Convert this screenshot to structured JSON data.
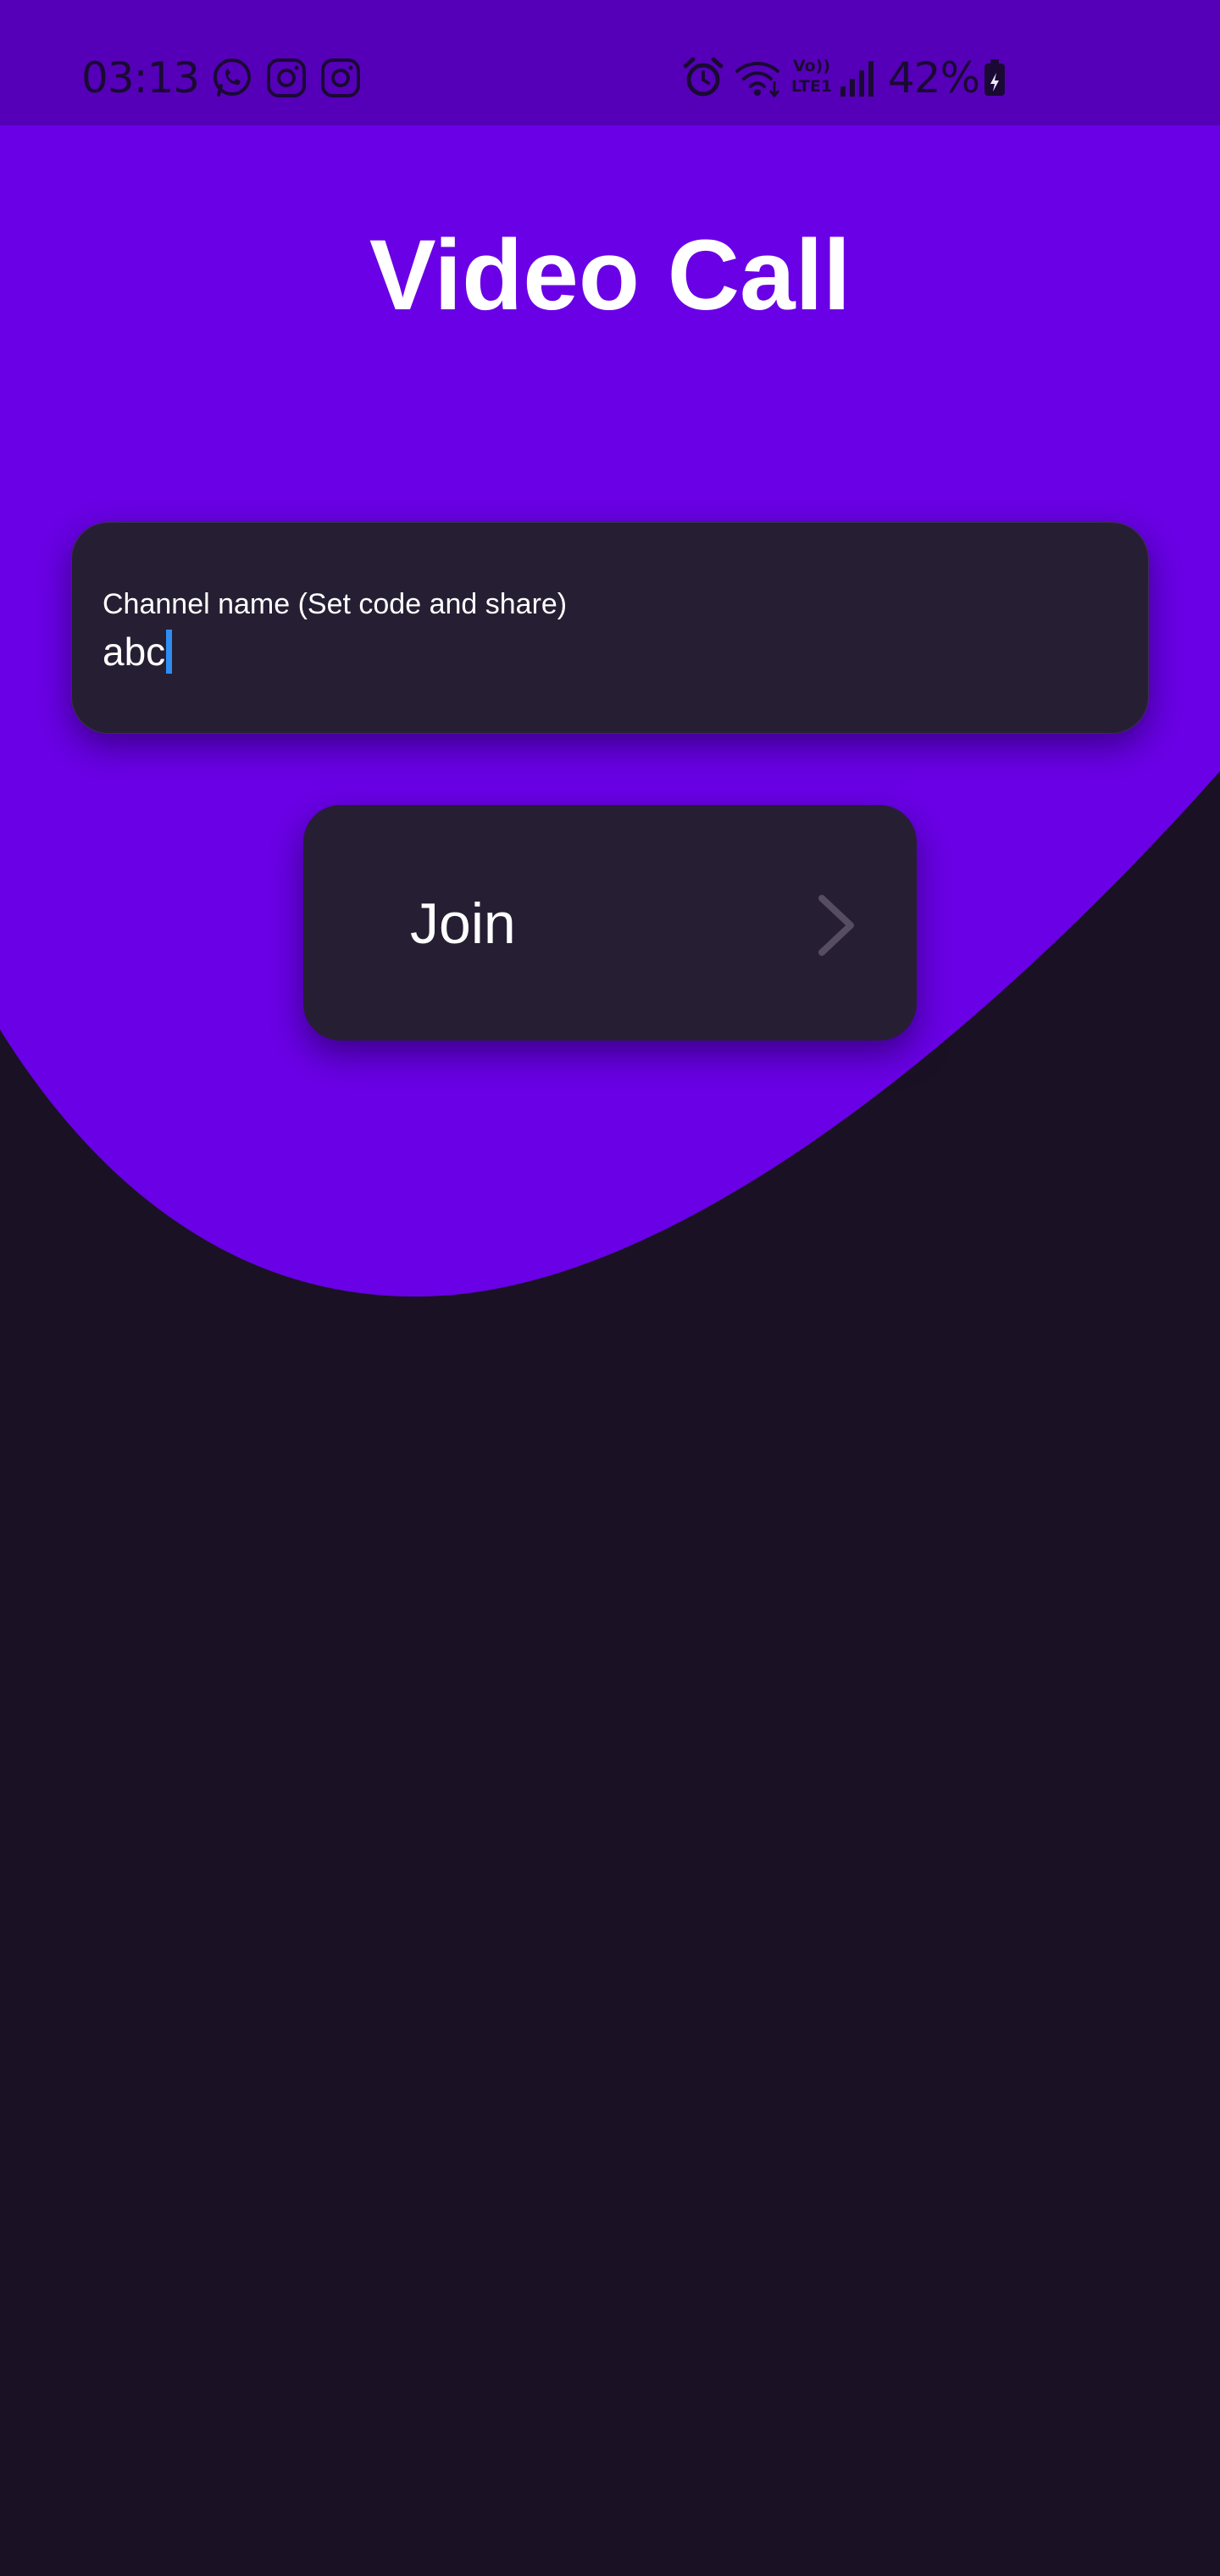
{
  "status_bar": {
    "time": "03:13",
    "battery": "42%",
    "left_icons": [
      "whatsapp-icon",
      "instagram-icon",
      "instagram-icon"
    ],
    "right_icons": [
      "alarm-icon",
      "wifi-icon",
      "volte-lte-icon",
      "signal-icon",
      "battery-charging-icon"
    ],
    "volte_text": "Vo))",
    "lte_text": "LTE1"
  },
  "app": {
    "title": "Video Call"
  },
  "channel_input": {
    "label": "Channel name (Set code and share)",
    "value": "abc"
  },
  "join_button": {
    "label": "Join",
    "icon": "chevron-right-icon"
  },
  "colors": {
    "primary": "#6a00e6",
    "status_bar": "#5500b8",
    "background": "#1a1224",
    "card": "#261f33",
    "caret": "#2f8df2",
    "text": "#ffffff"
  }
}
